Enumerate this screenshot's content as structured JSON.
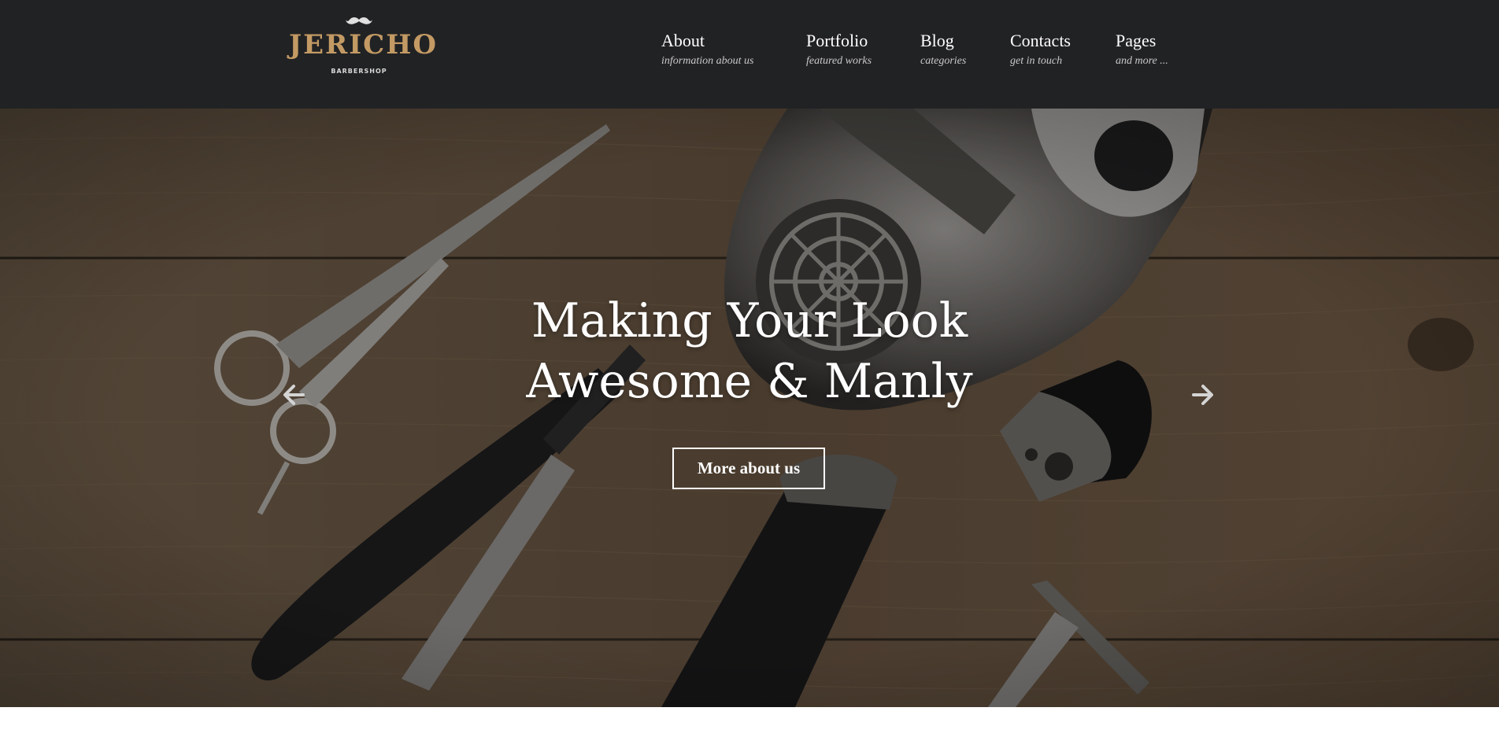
{
  "brand": {
    "name": "JERICHO",
    "tagline": "BARBERSHOP",
    "color": "#c39a64"
  },
  "nav": {
    "items": [
      {
        "label": "About",
        "sub": "information about us"
      },
      {
        "label": "Portfolio",
        "sub": "featured works"
      },
      {
        "label": "Blog",
        "sub": "categories"
      },
      {
        "label": "Contacts",
        "sub": "get in touch"
      },
      {
        "label": "Pages",
        "sub": "and more ..."
      }
    ]
  },
  "hero": {
    "title_line1": "Making Your Look",
    "title_line2": "Awesome & Manly",
    "button_label": "More about us",
    "prev_icon": "arrow-left-icon",
    "next_icon": "arrow-right-icon"
  },
  "colors": {
    "header_bg": "#212224",
    "text": "#ffffff",
    "subtext": "#c9c9c9"
  }
}
